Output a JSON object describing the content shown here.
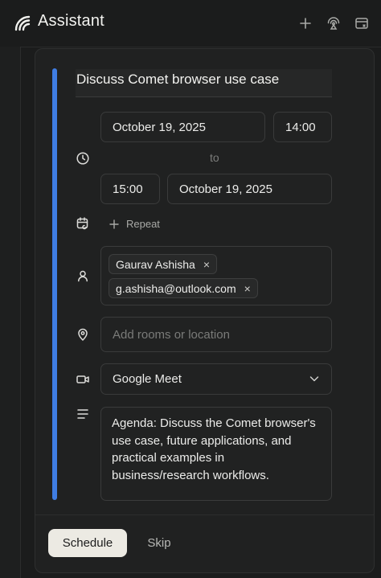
{
  "header": {
    "title": "Assistant",
    "icons": [
      "logo-icon",
      "plus-icon",
      "broadcast-icon",
      "window-icon"
    ]
  },
  "event": {
    "title": "Discuss Comet browser use case",
    "start_date": "October 19, 2025",
    "start_time": "14:00",
    "to_label": "to",
    "end_time": "15:00",
    "end_date": "October 19, 2025",
    "repeat_label": "Repeat",
    "attendees": [
      "Gaurav Ashisha",
      "g.ashisha@outlook.com"
    ],
    "remove_glyph": "×",
    "location_placeholder": "Add rooms or location",
    "conferencing": "Google Meet",
    "agenda": "Agenda: Discuss the Comet browser's use case, future applications, and practical examples in business/research workflows."
  },
  "footer": {
    "schedule_label": "Schedule",
    "skip_label": "Skip"
  },
  "colors": {
    "accent": "#3f7de3",
    "background": "#1b1c1c",
    "card": "#202121",
    "primary_button": "#eceae3"
  }
}
